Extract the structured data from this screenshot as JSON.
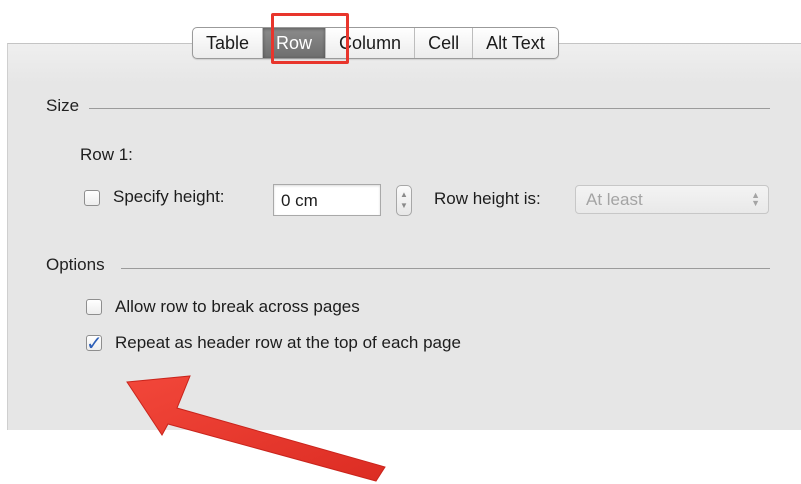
{
  "tabs": [
    {
      "label": "Table",
      "selected": false
    },
    {
      "label": "Row",
      "selected": true
    },
    {
      "label": "Column",
      "selected": false
    },
    {
      "label": "Cell",
      "selected": false
    },
    {
      "label": "Alt Text",
      "selected": false
    }
  ],
  "size_group": {
    "title": "Size",
    "row_label": "Row 1:",
    "specify_height": {
      "label": "Specify height:",
      "checked": false
    },
    "height_value": "0 cm",
    "row_height_label": "Row height is:",
    "row_height_select": {
      "selected": "At least",
      "enabled": false
    }
  },
  "options_group": {
    "title": "Options",
    "allow_break": {
      "label": "Allow row to break across pages",
      "checked": false
    },
    "repeat_header": {
      "label": "Repeat as header row at the top of each page",
      "checked": true
    }
  },
  "colors": {
    "highlight": "#e8352c",
    "panel": "#e6e6e6",
    "selected_tab": "#7a7a7a",
    "check_mark": "#2d5fb8"
  },
  "icons": {
    "checkmark": "checkmark-icon",
    "stepper": "stepper-arrows-icon",
    "select": "select-arrows-icon",
    "annotation": "red-arrow-annotation"
  }
}
